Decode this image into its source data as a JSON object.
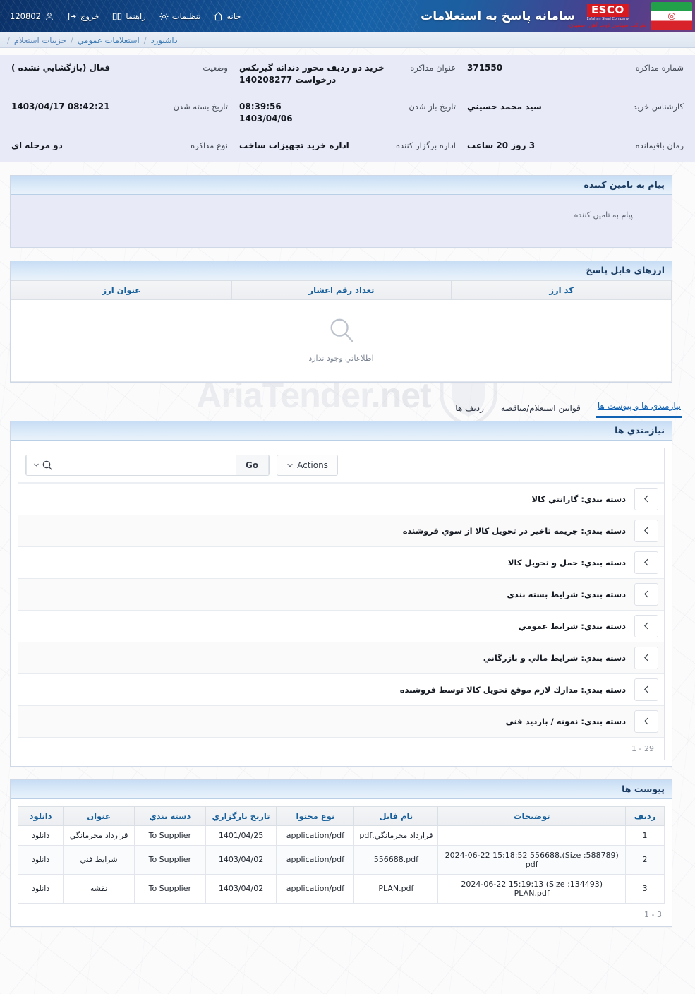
{
  "header": {
    "app_title": "سامانه پاسخ به استعلامات",
    "brand": {
      "esco_main": "ESCO",
      "esco_sub": "Esfahan Steel Company",
      "esco_fa": "شرکت سهامي ذوب آهن اصفهان"
    },
    "nav": [
      {
        "label": "خانه",
        "icon": "home-icon"
      },
      {
        "label": "تنظیمات",
        "icon": "gear-icon"
      },
      {
        "label": "راهنما",
        "icon": "book-icon"
      },
      {
        "label": "خروج",
        "icon": "logout-icon"
      }
    ],
    "user": {
      "id": "120802",
      "icon": "user-icon"
    }
  },
  "breadcrumb": {
    "items": [
      "داشبورد",
      "استعلامات عمومي",
      "جزییات استعلام"
    ],
    "separator": "/"
  },
  "info": {
    "fields": [
      {
        "label": "شماره مذاکره",
        "value": "371550",
        "dir": "ltr"
      },
      {
        "label": "عنوان مذاکره",
        "value": "خرید دو ردیف محور دندانه گیربکس\nدرخواست 140208277",
        "dir": "rtl"
      },
      {
        "label": "وضعیت",
        "value": "فعال (بازگشايي نشده )",
        "dir": "rtl"
      },
      {
        "label": "کارشناس خرید",
        "value": "سید محمد حسیني",
        "dir": "rtl"
      },
      {
        "label": "تاریخ باز شدن",
        "value": "08:39:56\n1403/04/06",
        "dir": "ltr"
      },
      {
        "label": "تاریخ بسته شدن",
        "value": "1403/04/17 08:42:21",
        "dir": "ltr"
      },
      {
        "label": "زمان باقیمانده",
        "value": "3 روز 20 ساعت",
        "dir": "rtl"
      },
      {
        "label": "اداره برگزار کننده",
        "value": "اداره خرید تجهیزات ساخت",
        "dir": "rtl"
      },
      {
        "label": "نوع مذاکره",
        "value": "دو مرحله اي",
        "dir": "rtl"
      }
    ]
  },
  "message_panel": {
    "title": "پیام به تامین کننده",
    "body": "پیام به تامین کننده"
  },
  "currencies_panel": {
    "title": "ارزهای قابل پاسخ",
    "columns": [
      "کد ارز",
      "تعداد رقم اعشار",
      "عنوان ارز"
    ],
    "rows": [],
    "empty_text": "اطلاعاتي وجود ندارد",
    "empty_icon": "magnifier-icon"
  },
  "tabs": [
    {
      "label": "نیازمندي ها و پیوست ها",
      "active": true
    },
    {
      "label": "قوانین استعلام/مناقصه",
      "active": false
    },
    {
      "label": "ردیف ها",
      "active": false
    }
  ],
  "requirements_panel": {
    "title": "نیازمندي ها",
    "toolbar": {
      "search_placeholder": "",
      "search_value": "",
      "go_label": "Go",
      "actions_label": "Actions",
      "search_icon": "magnifier-icon",
      "chevron_icon": "chevron-down-icon"
    },
    "rows": [
      {
        "label": "دسته بندي: گارانتي کالا",
        "toggle_icon": "chevron-left-icon"
      },
      {
        "label": "دسته بندي: جریمه تاخیر در تحویل کالا از سوي فروشنده",
        "toggle_icon": "chevron-left-icon"
      },
      {
        "label": "دسته بندي: حمل و تحویل کالا",
        "toggle_icon": "chevron-left-icon"
      },
      {
        "label": "دسته بندي: شرایط بسته بندي",
        "toggle_icon": "chevron-left-icon"
      },
      {
        "label": "دسته بندي: شرایط عمومي",
        "toggle_icon": "chevron-left-icon"
      },
      {
        "label": "دسته بندي: شرایط مالي و بازرگاني",
        "toggle_icon": "chevron-left-icon"
      },
      {
        "label": "دسته بندي: مدارك لازم موقع تحویل کالا توسط فروشنده",
        "toggle_icon": "chevron-left-icon"
      },
      {
        "label": "دسته بندي: نمونه / بازدید فني",
        "toggle_icon": "chevron-left-icon"
      }
    ],
    "footer": "29 - 1"
  },
  "attachments_panel": {
    "title": "پیوست ها",
    "columns": [
      "ردیف",
      "توضیحات",
      "نام فایل",
      "نوع محتوا",
      "تاریخ بارگزاري",
      "دسته بندي",
      "عنوان",
      "دانلود"
    ],
    "rows": [
      {
        "index": "1",
        "description": "",
        "file_name": "قرارداد محرمانگي.pdf",
        "content_type": "application/pdf",
        "upload_date": "1401/04/25",
        "category": "To Supplier",
        "title": "قرارداد محرمانگي",
        "download_label": "دانلود"
      },
      {
        "index": "2",
        "description": "2024-06-22 15:18:52 556688.(Size :588789) pdf",
        "file_name": "556688.pdf",
        "content_type": "application/pdf",
        "upload_date": "1403/04/02",
        "category": "To Supplier",
        "title": "شرایط فني",
        "download_label": "دانلود"
      },
      {
        "index": "3",
        "description": "2024-06-22 15:19:13 (Size :134493) PLAN.pdf",
        "file_name": "PLAN.pdf",
        "content_type": "application/pdf",
        "upload_date": "1403/04/02",
        "category": "To Supplier",
        "title": "نقشه",
        "download_label": "دانلود"
      }
    ],
    "footer": "3 - 1"
  },
  "watermark": {
    "text_a": "AriaTender",
    "text_b": ".net"
  },
  "colors": {
    "header_blue": "#114a8c",
    "accent_link": "#1f7ac0",
    "panel_head": "#c7ddf4",
    "info_bg": "#e8eaf7",
    "brand_red": "#d71920"
  }
}
